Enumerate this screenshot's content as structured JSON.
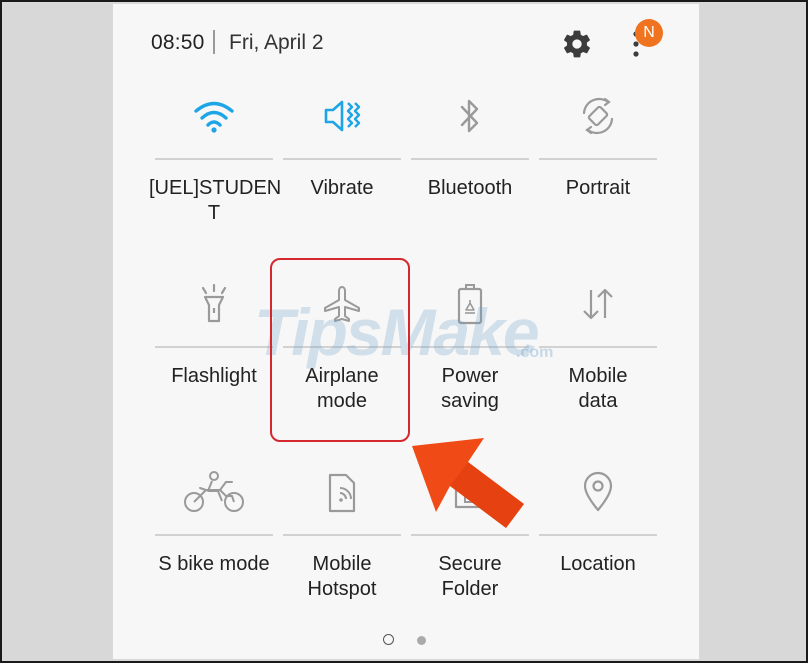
{
  "status_bar": {
    "time": "08:50",
    "date": "Fri, April 2",
    "notification_badge": "N"
  },
  "colors": {
    "accent": "#1ea5e6",
    "icon_inactive": "#9a9a9a",
    "highlight": "#d5282e",
    "arrow": "#f04a16",
    "badge": "#f0731f"
  },
  "tiles": [
    {
      "label": "[UEL]STUDEN\nT",
      "icon": "wifi-icon",
      "active": true
    },
    {
      "label": "Vibrate",
      "icon": "vibrate-icon",
      "active": true
    },
    {
      "label": "Bluetooth",
      "icon": "bluetooth-icon",
      "active": false
    },
    {
      "label": "Portrait",
      "icon": "rotate-icon",
      "active": false
    },
    {
      "label": "Flashlight",
      "icon": "flashlight-icon",
      "active": false
    },
    {
      "label": "Airplane\nmode",
      "icon": "airplane-icon",
      "active": false
    },
    {
      "label": "Power\nsaving",
      "icon": "battery-icon",
      "active": false
    },
    {
      "label": "Mobile\ndata",
      "icon": "data-arrows-icon",
      "active": false
    },
    {
      "label": "S bike mode",
      "icon": "motorbike-icon",
      "active": false
    },
    {
      "label": "Mobile\nHotspot",
      "icon": "hotspot-icon",
      "active": false
    },
    {
      "label": "Secure\nFolder",
      "icon": "secure-folder-icon",
      "active": false
    },
    {
      "label": "Location",
      "icon": "location-icon",
      "active": false
    }
  ],
  "watermark": {
    "brand": "TipsMake",
    "suffix": ".com"
  },
  "pagination": {
    "current": 1,
    "total": 2
  }
}
